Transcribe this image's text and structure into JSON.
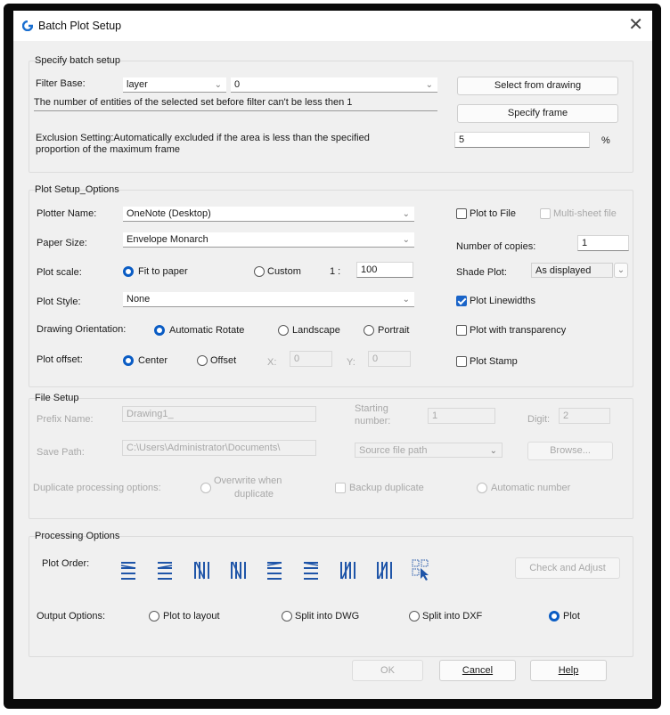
{
  "window": {
    "title": "Batch Plot Setup",
    "close_glyph": "✕"
  },
  "specify": {
    "group_label": "Specify batch setup",
    "filter_base_label": "Filter Base:",
    "filter_base_value": "layer",
    "filter_value": "0",
    "select_from_drawing_label": "Select from drawing",
    "note": "The number of entities of the selected set before filter can't be less then 1",
    "specify_frame_label": "Specify frame",
    "exclusion_text_line1": "Exclusion Setting:Automatically excluded if the area is less than the specified",
    "exclusion_text_line2": "proportion of the maximum frame",
    "exclusion_value": "5",
    "exclusion_unit": "%"
  },
  "plot_setup": {
    "group_label": "Plot Setup_Options",
    "plotter_name_label": "Plotter Name:",
    "plotter_name_value": "OneNote (Desktop)",
    "plot_to_file_label": "Plot to File",
    "plot_to_file_checked": false,
    "multi_sheet_label": "Multi-sheet file",
    "paper_size_label": "Paper Size:",
    "paper_size_value": "Envelope Monarch",
    "copies_label": "Number of copies:",
    "copies_value": "1",
    "plot_scale_label": "Plot scale:",
    "fit_to_paper_label": "Fit to paper",
    "custom_label": "Custom",
    "scale_ratio_label": "1 :",
    "scale_value": "100",
    "shade_plot_label": "Shade Plot:",
    "shade_plot_value": "As displayed",
    "plot_style_label": "Plot Style:",
    "plot_style_value": "None",
    "plot_linewidths_label": "Plot Linewidths",
    "plot_linewidths_checked": true,
    "orientation_label": "Drawing Orientation:",
    "auto_rotate_label": "Automatic Rotate",
    "landscape_label": "Landscape",
    "portrait_label": "Portrait",
    "plot_transparency_label": "Plot with transparency",
    "plot_transparency_checked": false,
    "plot_offset_label": "Plot offset:",
    "center_label": "Center",
    "offset_label": "Offset",
    "x_label": "X:",
    "x_value": "0",
    "y_label": "Y:",
    "y_value": "0",
    "plot_stamp_label": "Plot Stamp",
    "plot_stamp_checked": false
  },
  "file_setup": {
    "group_label": "File Setup",
    "prefix_label": "Prefix Name:",
    "prefix_value": "Drawing1_",
    "starting_label_line1": "Starting",
    "starting_label_line2": "number:",
    "starting_value": "1",
    "digit_label": "Digit:",
    "digit_value": "2",
    "save_path_label": "Save Path:",
    "save_path_value": "C:\\Users\\Administrator\\Documents\\",
    "source_path_value": "Source file path",
    "browse_label": "Browse...",
    "duplicate_label": "Duplicate processing options:",
    "overwrite_line1": "Overwrite when",
    "overwrite_line2": "duplicate",
    "backup_label": "Backup duplicate",
    "auto_number_label": "Automatic number"
  },
  "processing": {
    "group_label": "Processing Options",
    "plot_order_label": "Plot Order:",
    "order_icons": [
      "sort-left-right-top-bottom-icon",
      "sort-right-left-top-bottom-icon",
      "sort-top-bottom-left-right-icon",
      "sort-top-bottom-right-left-icon",
      "sort-left-right-bottom-top-icon",
      "sort-right-left-bottom-top-icon",
      "sort-bottom-top-left-right-icon",
      "sort-bottom-top-right-left-icon",
      "select-order-icon"
    ],
    "check_adjust_label": "Check and Adjust",
    "output_options_label": "Output Options:",
    "plot_to_layout_label": "Plot to layout",
    "split_dwg_label": "Split into DWG",
    "split_dxf_label": "Split into DXF",
    "plot_label": "Plot"
  },
  "footer": {
    "ok_label": "OK",
    "cancel_label": "Cancel",
    "help_label": "Help"
  },
  "colors": {
    "accent": "#0a5cc4",
    "checkbox": "#1a64c8",
    "background": "#f0f0f0",
    "disabled_text": "#a8a8a8"
  }
}
